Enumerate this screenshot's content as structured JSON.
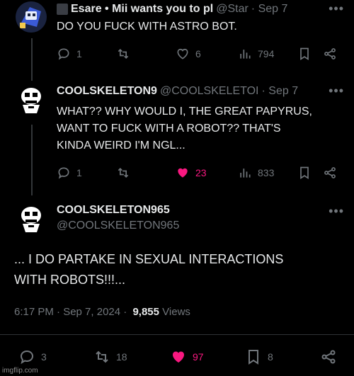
{
  "tweet1": {
    "name": "Esare • Mii wants you to pl",
    "handle": "@Star",
    "date": "· Sep 7",
    "text": "DO YOU FUCK WITH ASTRO BOT.",
    "replies": "1",
    "retweets": "",
    "likes": "6",
    "views": "794"
  },
  "tweet2": {
    "name": "COOLSKELETON9",
    "handle": "@COOLSKELETOI",
    "date": "· Sep 7",
    "text_lines": [
      "WHAT?? WHY WOULD I, THE GREAT PAPYRUS,",
      "WANT TO FUCK WITH A ROBOT?? THAT'S",
      "KINDA WEIRD I'M NGL..."
    ],
    "replies": "1",
    "retweets": "",
    "likes": "23",
    "views": "833"
  },
  "main": {
    "name": "COOLSKELETON965",
    "handle": "@COOLSKELETON965",
    "text_lines": [
      "... I DO PARTAKE IN SEXUAL INTERACTIONS",
      "WITH ROBOTS!!!..."
    ],
    "timestamp": "6:17 PM · Sep 7, 2024 ·",
    "views_count": "9,855",
    "views_label": "Views",
    "replies": "3",
    "retweets": "18",
    "likes": "97",
    "bookmarks": "8"
  },
  "watermark": "imgflip.com",
  "colors": {
    "like": "#f91880",
    "muted": "#71767b",
    "text": "#e7e9ea"
  }
}
